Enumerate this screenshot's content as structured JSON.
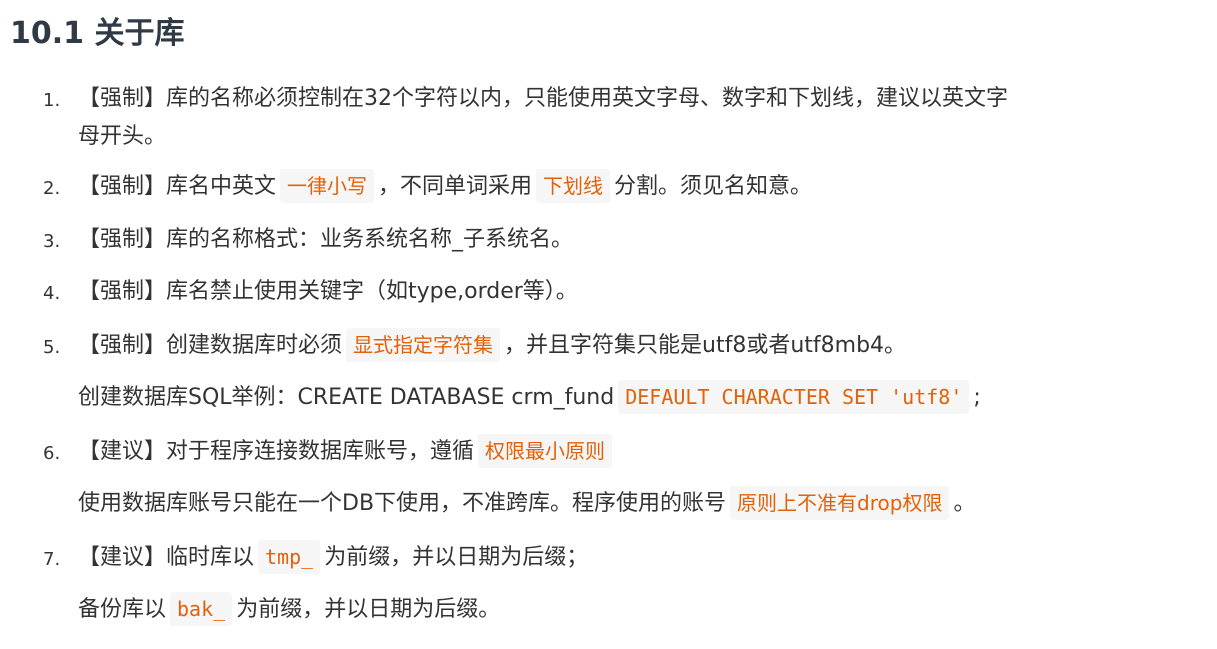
{
  "section": {
    "number": "10.1",
    "title": "关于库"
  },
  "rules": [
    {
      "number": "1.",
      "text_line1": "【强制】库的名称必须控制在32个字符以内，只能使用英文字母、数字和下划线，建议以英文字",
      "text_line2": "母开头。"
    },
    {
      "number": "2.",
      "prefix": "【强制】库名中英文",
      "code1": "一律小写",
      "middle": "，不同单词采用",
      "code2": "下划线",
      "suffix": "分割。须见名知意。"
    },
    {
      "number": "3.",
      "text": "【强制】库的名称格式：业务系统名称_子系统名。"
    },
    {
      "number": "4.",
      "text": "【强制】库名禁止使用关键字（如type,order等）。"
    },
    {
      "number": "5.",
      "prefix": "【强制】创建数据库时必须",
      "code1": "显式指定字符集",
      "suffix": "，并且字符集只能是utf8或者utf8mb4。",
      "note_prefix": "创建数据库SQL举例：CREATE DATABASE crm_fund",
      "note_code": "DEFAULT CHARACTER SET 'utf8'",
      "note_suffix": ";"
    },
    {
      "number": "6.",
      "prefix": "【建议】对于程序连接数据库账号，遵循",
      "code1": "权限最小原则",
      "note_prefix": "使用数据库账号只能在一个DB下使用，不准跨库。程序使用的账号",
      "note_code": "原则上不准有drop权限",
      "note_suffix": "。"
    },
    {
      "number": "7.",
      "prefix": "【建议】临时库以",
      "code1": "tmp_",
      "suffix": "为前缀，并以日期为后缀；",
      "note_prefix": "备份库以",
      "note_code": "bak_",
      "note_suffix": "为前缀，并以日期为后缀。"
    }
  ],
  "colors": {
    "text": "#333333",
    "heading": "#2f3a44",
    "code_text": "#e36209",
    "code_background": "#f6f6f6"
  }
}
